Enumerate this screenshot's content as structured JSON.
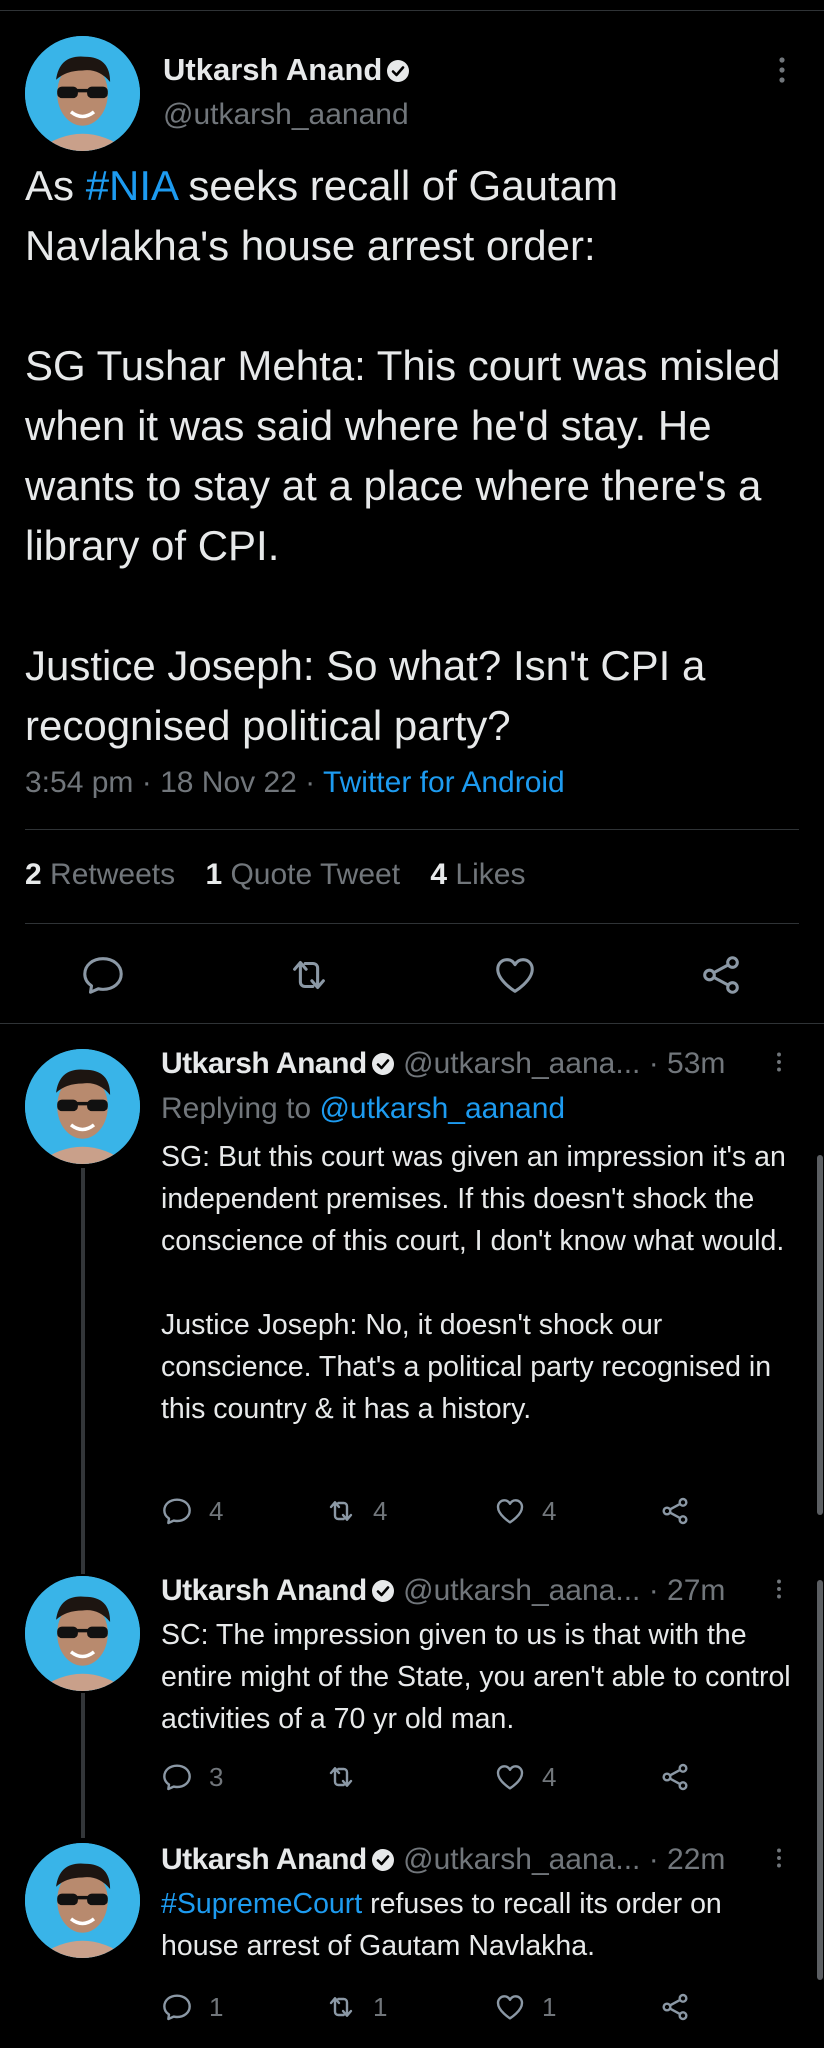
{
  "colors": {
    "accent": "#1d9bf0",
    "muted": "#71767b",
    "text": "#e7e9ea",
    "background": "#000000"
  },
  "main_tweet": {
    "author_name": "Utkarsh Anand",
    "author_handle": "@utkarsh_aanand",
    "text_prefix": "As ",
    "hashtag": "#NIA",
    "text_line1_rest": " seeks recall of Gautam Navlakha's house arrest order:",
    "paragraph2": "SG Tushar Mehta: This court was misled when it was said where he'd stay. He wants to stay at a place where there's a library of CPI.",
    "paragraph3": "Justice Joseph: So what? Isn't CPI a recognised political party?",
    "time": "3:54 pm",
    "date": "18 Nov 22",
    "source": "Twitter for Android",
    "stats": {
      "retweets_count": "2",
      "retweets_label": "Retweets",
      "quotes_count": "1",
      "quotes_label": "Quote Tweet",
      "likes_count": "4",
      "likes_label": "Likes"
    },
    "actions": [
      "reply-icon",
      "retweet-icon",
      "like-icon",
      "share-icon"
    ]
  },
  "replies": [
    {
      "author_name": "Utkarsh Anand",
      "author_handle": "@utkarsh_aana...",
      "time": "· 53m",
      "replying_to_label": "Replying to",
      "replying_to_handle": "@utkarsh_aanand",
      "paragraph1": "SG: But this court was given an impression it's an independent premises. If this doesn't shock the conscience of this court, I don't know what would.",
      "paragraph2": "Justice Joseph: No, it doesn't shock our conscience. That's a political party recognised in this country & it has a history.",
      "reply_count": "4",
      "retweet_count": "4",
      "like_count": "4"
    },
    {
      "author_name": "Utkarsh Anand",
      "author_handle": "@utkarsh_aana...",
      "time": "· 27m",
      "paragraph1": "SC: The impression given to us is that with the entire might of the State, you aren't able to control activities of a 70 yr old man.",
      "reply_count": "3",
      "retweet_count": "",
      "like_count": "4"
    },
    {
      "author_name": "Utkarsh Anand",
      "author_handle": "@utkarsh_aana...",
      "time": "· 22m",
      "hashtag": "#SupremeCourt",
      "text_rest": " refuses to recall its order on house arrest of Gautam Navlakha.",
      "reply_count": "1",
      "retweet_count": "1",
      "like_count": "1"
    }
  ]
}
